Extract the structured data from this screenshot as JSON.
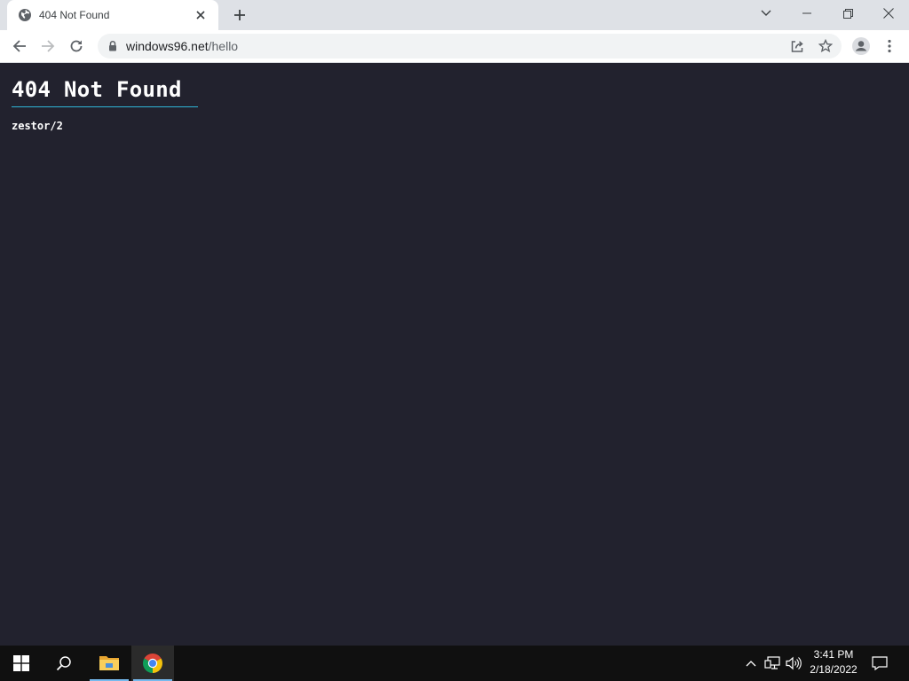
{
  "browser": {
    "tab": {
      "title": "404 Not Found",
      "favicon": "globe-icon"
    },
    "address": {
      "host": "windows96.net",
      "path": "/hello"
    }
  },
  "page": {
    "heading": "404 Not Found",
    "server_signature": "zestor/2",
    "colors": {
      "background": "#22222e",
      "rule": "#2fb6d8",
      "text": "#ffffff"
    }
  },
  "taskbar": {
    "apps": [
      "start-icon",
      "search-icon",
      "file-explorer-icon",
      "chrome-icon"
    ],
    "clock": {
      "time": "3:41 PM",
      "date": "2/18/2022"
    }
  }
}
